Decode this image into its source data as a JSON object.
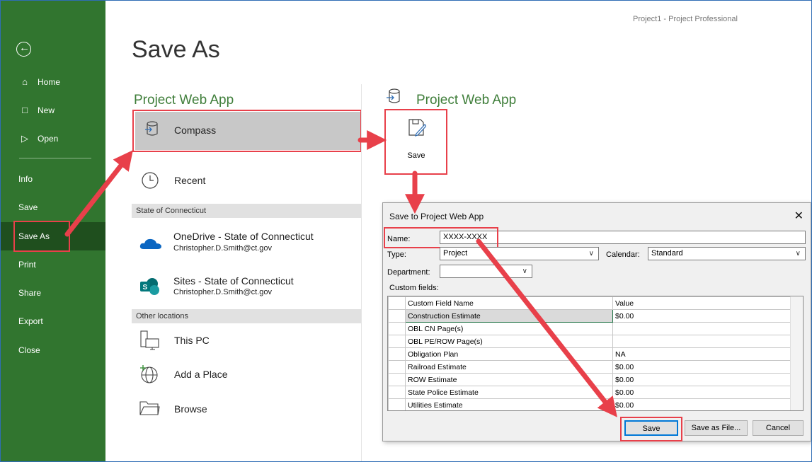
{
  "window": {
    "title": "Project1 - Project Professional"
  },
  "nav": {
    "back_icon": "back-arrow-icon",
    "items": [
      {
        "label": "Home",
        "icon": "home-icon"
      },
      {
        "label": "New",
        "icon": "new-document-icon"
      },
      {
        "label": "Open",
        "icon": "folder-open-icon"
      },
      {
        "label": "Info"
      },
      {
        "label": "Save"
      },
      {
        "label": "Save As",
        "selected": true
      },
      {
        "label": "Print"
      },
      {
        "label": "Share"
      },
      {
        "label": "Export"
      },
      {
        "label": "Close"
      }
    ]
  },
  "page": {
    "title": "Save As",
    "left_section": "Project Web App",
    "compass": "Compass",
    "recent": "Recent",
    "group_state": "State of Connecticut",
    "onedrive_name": "OneDrive - State of Connecticut",
    "onedrive_email": "Christopher.D.Smith@ct.gov",
    "sites_name": "Sites - State of Connecticut",
    "sites_email": "Christopher.D.Smith@ct.gov",
    "group_other": "Other locations",
    "this_pc": "This PC",
    "add_place": "Add a Place",
    "browse": "Browse",
    "right_section": "Project Web App",
    "save_tile": "Save"
  },
  "dialog": {
    "title": "Save to Project Web App",
    "name_label": "Name:",
    "name_value": "XXXX-XXXX",
    "type_label": "Type:",
    "type_value": "Project",
    "calendar_label": "Calendar:",
    "calendar_value": "Standard",
    "department_label": "Department:",
    "department_value": "",
    "custom_fields_label": "Custom fields:",
    "col_name": "Custom Field Name",
    "col_value": "Value",
    "rows": [
      {
        "name": "Construction Estimate",
        "value": "$0.00"
      },
      {
        "name": "OBL CN Page(s)",
        "value": ""
      },
      {
        "name": "OBL PE/ROW Page(s)",
        "value": ""
      },
      {
        "name": "Obligation Plan",
        "value": "NA"
      },
      {
        "name": "Railroad Estimate",
        "value": "$0.00"
      },
      {
        "name": "ROW Estimate",
        "value": "$0.00"
      },
      {
        "name": "State Police Estimate",
        "value": "$0.00"
      },
      {
        "name": "Utilities Estimate",
        "value": "$0.00"
      }
    ],
    "save_button": "Save",
    "save_as_file_button": "Save as File...",
    "cancel_button": "Cancel"
  },
  "colors": {
    "nav": "#31752f",
    "accent_green": "#3f7e3a",
    "callout_red": "#e8404a"
  }
}
